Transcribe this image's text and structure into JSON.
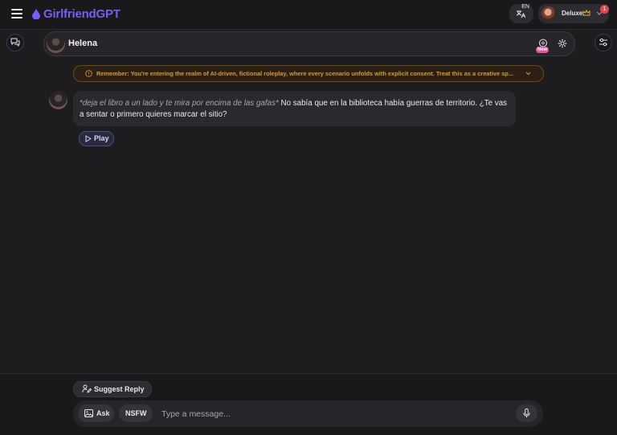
{
  "app": {
    "brand": "GirlfriendGPT",
    "accent": "#7b5cf0"
  },
  "topbar": {
    "menu_icon": "hamburger-icon",
    "lang_code": "EN",
    "lang_icon": "translate-icon",
    "user": {
      "plan_label": "Deluxe",
      "plan_icon": "crown-icon",
      "notification_count": "1"
    }
  },
  "chat": {
    "character_name": "Helena",
    "header_badge": "New",
    "notice": "Remember: You're entering the realm of AI-driven, fictional roleplay, where every scenario unfolds with explicit consent. Treat this as a creative sp...",
    "messages": [
      {
        "action": "*deja el libro a un lado y te mira por encima de las gafas*",
        "text": " No sabía que en la biblioteca había guerras de territorio. ¿Te vas a sentar o primero quieres marcar el sitio?",
        "play_label": "Play"
      }
    ]
  },
  "composer": {
    "suggest_label": "Suggest Reply",
    "ask_label": "Ask",
    "nsfw_label": "NSFW",
    "placeholder": "Type a message..."
  }
}
